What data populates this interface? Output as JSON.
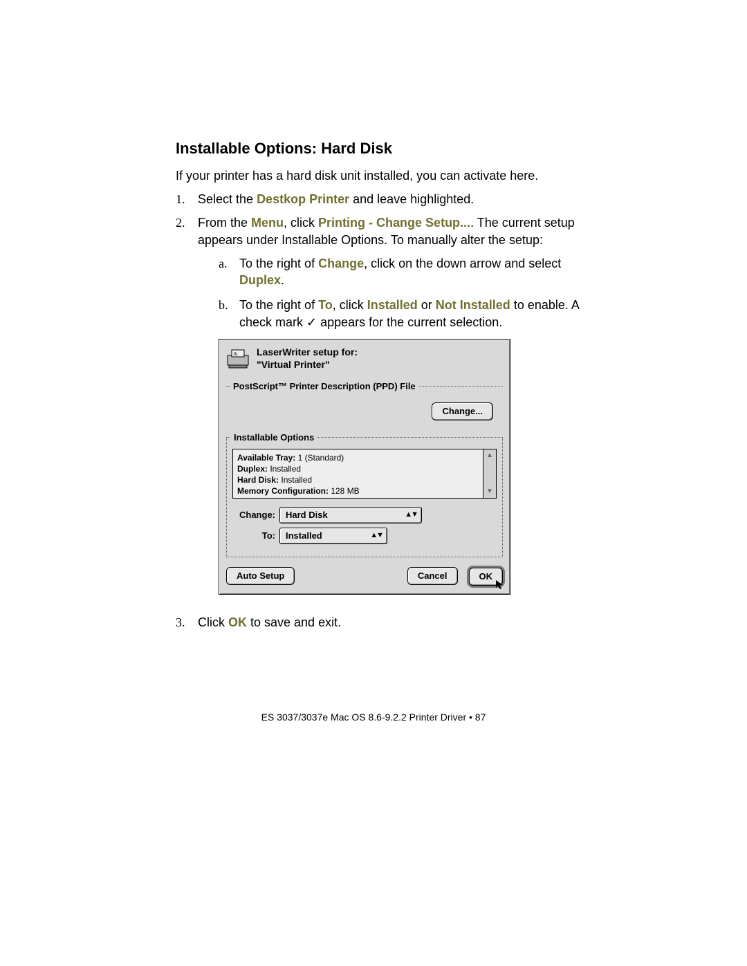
{
  "heading": "Installable Options: Hard Disk",
  "intro": "If your printer has a hard disk unit installed, you can activate here.",
  "step1": {
    "num": "1.",
    "pre": "Select the ",
    "link": "Destkop Printer",
    "post": " and leave highlighted."
  },
  "step2": {
    "num": "2.",
    "t1": "From the ",
    "w_menu": "Menu",
    "t2": ", click ",
    "w_print": "Printing",
    "dash": " - ",
    "w_change": "Change Setup...",
    "t3": ".  The current setup appears under Installable Options. To manually alter the setup:",
    "a": {
      "num": "a.",
      "t1": "To the right of ",
      "w_change": "Change",
      "t2": ", click on the down arrow and select ",
      "w_duplex": "Duplex",
      "t3": "."
    },
    "b": {
      "num": "b.",
      "t1": "To the right of ",
      "w_to": "To",
      "t2": ", click ",
      "w_inst": "Installed",
      "t3": " or ",
      "w_ninst": "Not Installed",
      "t4": " to enable. A check mark ✓ appears for the current selection."
    }
  },
  "step3": {
    "num": "3.",
    "t1": "Click ",
    "w_ok": "OK",
    "t2": " to save and exit."
  },
  "dialog": {
    "title1": "LaserWriter setup for:",
    "title2": "\"Virtual Printer\"",
    "ppd_legend": "PostScript™ Printer Description (PPD) File",
    "ppd_change": "Change...",
    "io_legend": "Installable Options",
    "rows": {
      "r0_label": "Available Tray:",
      "r0_value": " 1 (Standard)",
      "r1_label": "Duplex:",
      "r1_value": " Installed",
      "r2_label": "Hard Disk:",
      "r2_value": " Installed",
      "r3_label": "Memory Configuration:",
      "r3_value": " 128 MB"
    },
    "change_label": "Change:",
    "change_value": "Hard Disk",
    "to_label": "To:",
    "to_value": "Installed",
    "auto_setup": "Auto Setup",
    "cancel": "Cancel",
    "ok": "OK"
  },
  "footer": "ES 3037/3037e Mac OS 8.6-9.2.2 Printer Driver • 87"
}
